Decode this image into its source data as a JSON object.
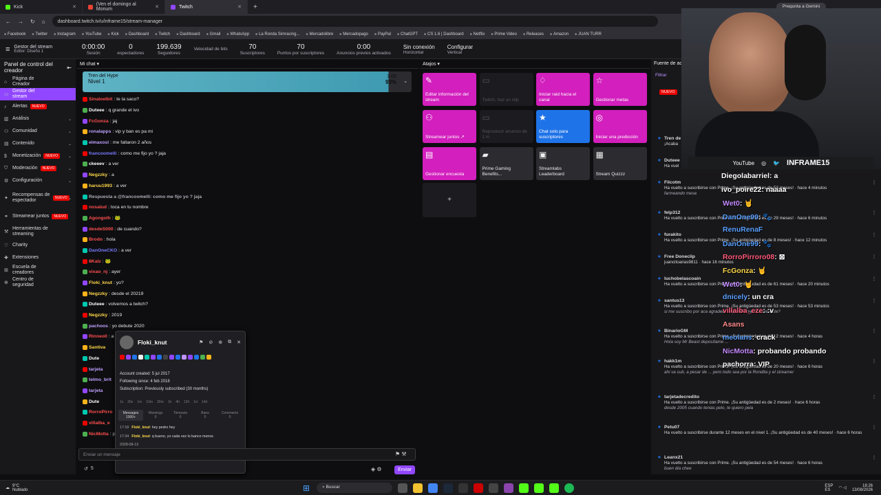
{
  "browser": {
    "tabs": [
      {
        "label": "Kick",
        "color": "#53fc18"
      },
      {
        "label": "(Ven el domingo al Monum",
        "color": "#ea4335"
      },
      {
        "label": "Twitch",
        "color": "#9147ff"
      }
    ],
    "url": "dashboard.twitch.tv/u/inframe15/stream-manager",
    "gemini": "Pregunta a Gemini"
  },
  "bookmarks": [
    "Facebook",
    "Twitter",
    "Instagram",
    "YouTube",
    "Kick",
    "Dashboard",
    "Twitch",
    "Dashboard",
    "Gmail",
    "WhatsApp",
    "La Ronda Simracing...",
    "Mercadolibre",
    "Mercadopago",
    "PayPal",
    "ChatGPT",
    "CS 1.6 | Dashboard",
    "Netflix",
    "Prime Video",
    "Releases",
    "Amazon",
    "JUAN TURR"
  ],
  "topbar": {
    "title": "Gestor del stream",
    "subtitle": "Editor: Diseño 1",
    "stats": [
      {
        "value": "0:00:00",
        "label": "Sesión"
      },
      {
        "value": "0",
        "label": "espectadores"
      },
      {
        "value": "199.639",
        "label": "Seguidores"
      },
      {
        "value": "",
        "label": "Velocidad de bits"
      },
      {
        "value": "70",
        "label": "Suscriptores"
      },
      {
        "value": "70",
        "label": "Puntos por suscriptores"
      },
      {
        "value": "0:00",
        "label": "Anuncios previos activados"
      }
    ],
    "layout1": "Sin conexión",
    "layout1b": "Horizontal",
    "layout2": "Configurar",
    "layout2b": "Vertical"
  },
  "sidebar": {
    "title": "Panel de control del creador",
    "items": [
      {
        "label": "Página de Creador",
        "icon": "home-icon"
      },
      {
        "label": "Gestor del stream",
        "icon": "stream-icon",
        "selected": true
      },
      {
        "label": "Alertas",
        "badge": "NUEVO",
        "icon": "alert-icon"
      },
      {
        "label": "Análisis",
        "icon": "chart-icon"
      },
      {
        "label": "Comunidad",
        "icon": "community-icon"
      },
      {
        "label": "Contenido",
        "icon": "content-icon"
      },
      {
        "label": "Monetización",
        "badge": "NUEVO",
        "icon": "money-icon"
      },
      {
        "label": "Moderación",
        "badge": "NUEVO",
        "icon": "shield-icon"
      },
      {
        "label": "Configuración",
        "icon": "gear-icon"
      },
      {
        "label": "Recompensas de espectador",
        "badge": "NUEVO",
        "icon": "gift-icon"
      },
      {
        "label": "Streamear juntos",
        "badge": "NUEVO",
        "icon": "group-icon"
      },
      {
        "label": "Herramientas de streaming",
        "icon": "tools-icon"
      },
      {
        "label": "Charity",
        "icon": "heart-icon"
      },
      {
        "label": "Extensiones",
        "icon": "puzzle-icon"
      },
      {
        "label": "Escuela de creadores",
        "icon": "school-icon"
      },
      {
        "label": "Centro de seguridad",
        "icon": "safety-icon"
      }
    ]
  },
  "chat": {
    "header": "Mi chat",
    "hype": {
      "title": "Tren del Hype",
      "level": "Nivel 1",
      "time": "3:00",
      "pct": "93%"
    },
    "messages": [
      {
        "user": "Sinaloelbit",
        "color": "#ff4f4f",
        "text": ": te la saco?"
      },
      {
        "user": "Duteee",
        "color": "#ffffff",
        "text": ": q grande el ivo"
      },
      {
        "user": "FcGonza",
        "color": "#ff4f4f",
        "text": ": jaj"
      },
      {
        "user": "ronalapps",
        "color": "#bfa2ff",
        "text": ": vip y ban es pa mi"
      },
      {
        "user": "elmaxosl",
        "color": "#bfa2ff",
        "text": ": me faltaron 2 años"
      },
      {
        "user": "francoomelli",
        "color": "#7a7aff",
        "text": ": como me fijo yo ? jaja"
      },
      {
        "user": "ckeeev",
        "color": "#ffffff",
        "text": ": a ver"
      },
      {
        "user": "Negzzky",
        "color": "#ffd84a",
        "text": ": a"
      },
      {
        "user": "haruu1993",
        "color": "#ffd84a",
        "text": ": a ver"
      },
      {
        "user": "Respuesta a @francoomelli: como me fijo yo ? jaja",
        "color": "#adadb8",
        "text": ""
      },
      {
        "user": "nosalud",
        "color": "#ff4f4f",
        "text": ": toca en tu nombre"
      },
      {
        "user": "Agongolh",
        "color": "#ff4f4f",
        "text": ": 🐸"
      },
      {
        "user": "desdeS000",
        "color": "#ff4f4f",
        "text": ": de cuando?"
      },
      {
        "user": "Brodo",
        "color": "#ff4f4f",
        "text": ": hola"
      },
      {
        "user": "DanOneCKO",
        "color": "#7a7aff",
        "text": ": a ver"
      },
      {
        "user": "8Kalz",
        "color": "#ff4f4f",
        "text": ": 🐸"
      },
      {
        "user": "vixao_nj",
        "color": "#ff4f4f",
        "text": ": ayer"
      },
      {
        "user": "Floki_knut",
        "color": "#ffd84a",
        "text": ": yo?"
      },
      {
        "user": "Negzzky",
        "color": "#ffd84a",
        "text": ": desde el 20219"
      },
      {
        "user": "Duteee",
        "color": "#ffffff",
        "text": ": volvemos a twitch?"
      },
      {
        "user": "Negzzky",
        "color": "#ffd84a",
        "text": ": 2019"
      },
      {
        "user": "pachoos",
        "color": "#bfa2ff",
        "text": ": yo debute 2020"
      },
      {
        "user": "Rinneo0",
        "color": "#ff4f4f",
        "text": ": a"
      },
      {
        "user": "Santiva",
        "color": "#ffd84a",
        "text": ""
      },
      {
        "user": "Dute",
        "color": "#ffffff",
        "text": ""
      },
      {
        "user": "tarjeta",
        "color": "#bfa2ff",
        "text": ""
      },
      {
        "user": "telmo_brit",
        "color": "#bfa2ff",
        "text": ""
      },
      {
        "user": "tarjeta",
        "color": "#bfa2ff",
        "text": ""
      },
      {
        "user": "Dute",
        "color": "#ffffff",
        "text": ""
      },
      {
        "user": "RorroPirro",
        "color": "#ff4f4f",
        "text": ""
      },
      {
        "user": "villalba_e",
        "color": "#ff4f4f",
        "text": ""
      },
      {
        "user": "NicMotta",
        "color": "#ff4f4f",
        "text": ": pro"
      }
    ],
    "input_placeholder": "Enviar un mensaje",
    "send": "Enviar",
    "points": "5"
  },
  "usercard": {
    "name": "Floki_knut",
    "created": "Account created: 5 jul 2017",
    "following": "Following since: 4 feb 2018",
    "subscription": "Subscription: Previously subscribed (30 months)",
    "timeouts": [
      "1s",
      "30s",
      "1m",
      "10m",
      "30m",
      "1h",
      "4h",
      "12h",
      "1d",
      "14d"
    ],
    "tabs": [
      "Messages",
      "Warnings",
      "Timeouts",
      "Bans",
      "Comments"
    ],
    "tab_counts": [
      "1000+",
      "0",
      "0",
      "0",
      "0"
    ],
    "history": [
      {
        "time": "17:18",
        "user": "Floki_knut",
        "text": ": hey pedro hey"
      },
      {
        "time": "17:34",
        "user": "Floki_knut",
        "text": ": q bueno, yo cada vez lo banco menos"
      },
      {
        "time": "2028-08-13",
        "user": "",
        "text": ""
      },
      {
        "time": "18:17",
        "user": "Floki_knut",
        "text": ": yo?"
      }
    ]
  },
  "atajos": {
    "header": "Atajos",
    "tiles": [
      {
        "label": "Editar información del stream",
        "style": "pink",
        "icon": "✎"
      },
      {
        "label": "Twitch, haz un clip",
        "style": "dark",
        "icon": "▭"
      },
      {
        "label": "Iniciar raid hacia el canal",
        "style": "pink",
        "icon": "♢"
      },
      {
        "label": "Gestionar metas",
        "style": "pink",
        "icon": "☆"
      },
      {
        "label": "Streamear juntos ↗",
        "style": "pink",
        "icon": "⚇"
      },
      {
        "label": "Reproducir anuncio de 1 m",
        "style": "dark",
        "icon": "▭"
      },
      {
        "label": "Chat solo para suscriptores",
        "style": "blue",
        "icon": "★"
      },
      {
        "label": "Iniciar una predicción",
        "style": "pink",
        "icon": "◎"
      },
      {
        "label": "Gestionar encuesta",
        "style": "pink",
        "icon": "▤"
      },
      {
        "label": "Prime Gaming Benefits...",
        "style": "grey",
        "icon": "▰"
      },
      {
        "label": "Streamlabs Leaderboard",
        "style": "grey",
        "icon": "▣"
      },
      {
        "label": "Stream Quizzz",
        "style": "grey",
        "icon": "▦"
      }
    ],
    "add": "+"
  },
  "feed": {
    "header": "Fuente de ac",
    "filter": "Filtrar",
    "badge": "NUEVO",
    "items": [
      {
        "name": "Tren de",
        "text": "¡Acaba"
      },
      {
        "name": "Duteee",
        "text": "Ha vuel"
      },
      {
        "name": "Filcotm",
        "text": "Ha vuelto a suscribirse con Prime. ¡Su antigüedad es de 53 meses! · hace 4 minutos",
        "note": "farmeando mese"
      },
      {
        "name": "felp312",
        "text": "Ha vuelto a suscribirse con Prime. ¡Su antigüedad es de 29 meses! · hace 6 minutos"
      },
      {
        "name": "furakito",
        "text": "Ha vuelto a suscribirse con Prime. ¡Su antigüedad es de 8 meses! · hace 12 minutos"
      },
      {
        "name": "Free Doneclip",
        "text": "juancitoarias9811 · hace 16 minutos"
      },
      {
        "name": "luchobelascoain",
        "text": "Ha vuelto a suscribirse con Prime. ¡Su antigüedad es de 61 meses! · hace 20 minutos"
      },
      {
        "name": "santus13",
        "text": "Ha vuelto a suscribirse con Prime. ¡Su antigüedad es de 53 meses! · hace 53 minutos",
        "note": "si me suscribo por aca agradece el pelado mercenario este?"
      },
      {
        "name": "BinarioGM",
        "text": "Ha vuelto a suscribirse con Prime. ¡Su antigüedad es de 12 meses! · hace 4 horas",
        "note": "Hola soy Mr Beast deposítame ..."
      },
      {
        "name": "hakk1m",
        "text": "Ha vuelto a suscribirse con Prime. ¡Su antigüedad es de 20 meses! · hace 6 horas",
        "note": "ahi va sub, a pesar de ... pero todo sea por la Rondita y el streamer"
      },
      {
        "name": "tarjetadecredito",
        "text": "Ha vuelto a suscribirse con Prime. ¡Su antigüedad es de 2 meses! · hace 6 horas",
        "note": "desde 2005 cuando tenias pelo, te quiero pela"
      },
      {
        "name": "Petu07",
        "text": "Ha vuelto a suscribirse durante 12 meses en el nivel 1. ¡Su antigüedad es de 40 meses! · hace 6 horas"
      },
      {
        "name": "Leanx21",
        "text": "Ha vuelto a suscribirse con Prime. ¡Su antigüedad es de 54 meses! · hace 6 horas",
        "note": "buen dia chee"
      }
    ]
  },
  "webcam": {
    "banner": "INFRAME15",
    "youtube": "YouTube"
  },
  "overlay_chat": [
    {
      "user": "Diegolabarriel",
      "text": ": a",
      "color": "#ffffff"
    },
    {
      "user": "ivo_poire22",
      "text": ": naaaa",
      "color": "#ffffff"
    },
    {
      "user": "Wet0",
      "text": ": 🤘",
      "color": "#c58bff"
    },
    {
      "user": "DanOne99",
      "text": ": 🐾",
      "color": "#5aa0ff"
    },
    {
      "user": "RenuRenaF",
      "text": "",
      "color": "#5aa0ff"
    },
    {
      "user": "DanOne99",
      "text": ": 🐾",
      "color": "#5aa0ff"
    },
    {
      "user": "RorroPirroro08",
      "text": ": ⊠",
      "color": "#ff5a7a"
    },
    {
      "user": "FcGonza",
      "text": ": 🤘",
      "color": "#ffd84a"
    },
    {
      "user": "Wet0",
      "text": ": 🤘",
      "color": "#c58bff"
    },
    {
      "user": "dnicely",
      "text": ": un cra",
      "color": "#5aa0ff"
    },
    {
      "user": "villalba_eze",
      "text": ": :v",
      "color": "#ff5a7a"
    },
    {
      "user": "Asans",
      "text": "",
      "color": "#ff8a8a"
    },
    {
      "user": "meolans",
      "text": ": crack",
      "color": "#5aa0ff"
    },
    {
      "user": "NicMotta",
      "text": ": probando probando",
      "color": "#c58bff"
    },
    {
      "user": "pachorra",
      "text": ": VIP",
      "color": "#ffffff"
    }
  ],
  "taskbar": {
    "weather": "9°C",
    "weather_desc": "Nublado",
    "search": "Buscar",
    "lang": "ESP",
    "lang2": "ES",
    "time": "18:26",
    "date": "13/08/2026"
  }
}
